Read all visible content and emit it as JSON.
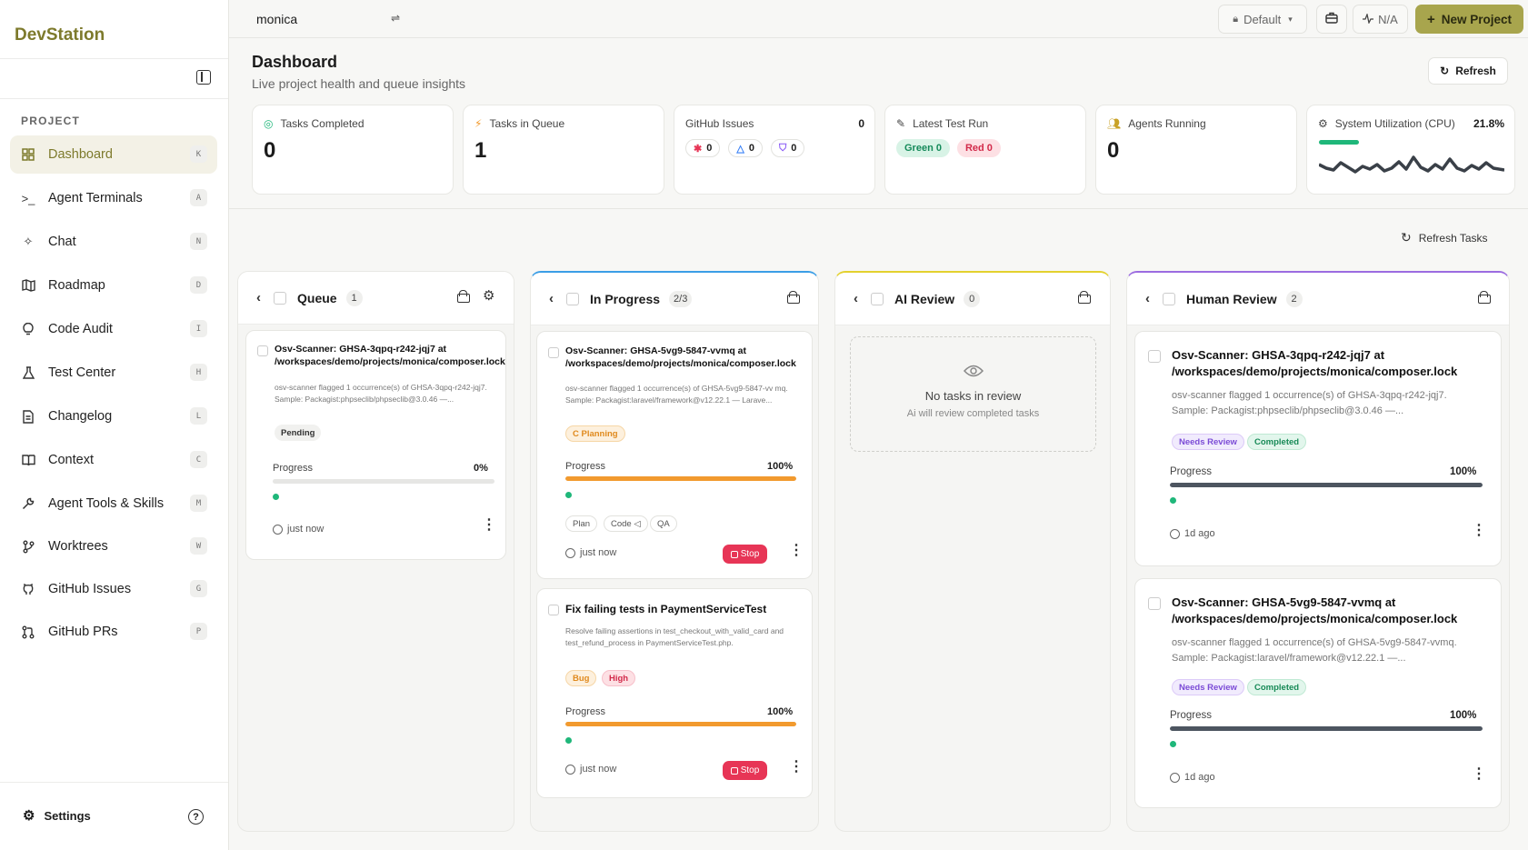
{
  "app": {
    "name": "DevStation",
    "project": "monica"
  },
  "sidebar": {
    "section_label": "PROJECT",
    "items": [
      {
        "label": "Dashboard",
        "shortcut": "K",
        "icon": "grid-icon"
      },
      {
        "label": "Agent Terminals",
        "shortcut": "A",
        "icon": "terminal-icon"
      },
      {
        "label": "Chat",
        "shortcut": "N",
        "icon": "sparkle-icon"
      },
      {
        "label": "Roadmap",
        "shortcut": "D",
        "icon": "map-icon"
      },
      {
        "label": "Code Audit",
        "shortcut": "I",
        "icon": "lightbulb-icon"
      },
      {
        "label": "Test Center",
        "shortcut": "H",
        "icon": "flask-icon"
      },
      {
        "label": "Changelog",
        "shortcut": "L",
        "icon": "document-icon"
      },
      {
        "label": "Context",
        "shortcut": "C",
        "icon": "book-icon"
      },
      {
        "label": "Agent Tools & Skills",
        "shortcut": "M",
        "icon": "wrench-icon"
      },
      {
        "label": "Worktrees",
        "shortcut": "W",
        "icon": "git-branch-icon"
      },
      {
        "label": "GitHub Issues",
        "shortcut": "G",
        "icon": "github-icon"
      },
      {
        "label": "GitHub PRs",
        "shortcut": "P",
        "icon": "git-pull-request-icon"
      }
    ],
    "settings_label": "Settings"
  },
  "topbar": {
    "profile_label": "Default",
    "status_label": "N/A",
    "new_project_label": "New Project"
  },
  "page": {
    "title": "Dashboard",
    "subtitle": "Live project health and queue insights",
    "refresh_label": "Refresh",
    "refresh_tasks_label": "Refresh Tasks"
  },
  "stats": {
    "tasks_completed": {
      "label": "Tasks Completed",
      "value": "0"
    },
    "tasks_in_queue": {
      "label": "Tasks in Queue",
      "value": "1"
    },
    "github_issues": {
      "label": "GitHub Issues",
      "total": "0",
      "bugs": "0",
      "warnings": "0",
      "security": "0"
    },
    "latest_test_run": {
      "label": "Latest Test Run",
      "green": "Green 0",
      "red": "Red 0"
    },
    "agents_running": {
      "label": "Agents Running",
      "value": "0"
    },
    "cpu": {
      "label": "System Utilization (CPU)",
      "value": "21.8%",
      "fraction": 0.218
    }
  },
  "columns": {
    "queue": {
      "title": "Queue",
      "count": "1",
      "cards": [
        {
          "title": "Osv-Scanner: GHSA-3qpq-r242-jqj7 at /workspaces/demo/projects/monica/composer.lock",
          "desc": "osv-scanner flagged 1 occurrence(s) of GHSA-3qpq-r242-jqj7. Sample: Packagist:phpseclib/phpseclib@3.0.46 —...",
          "tag": "Pending",
          "progress_label": "Progress",
          "progress": "0%",
          "progress_fraction": 0,
          "time": "just now"
        }
      ]
    },
    "in_progress": {
      "title": "In Progress",
      "count": "2/3",
      "cards": [
        {
          "title": "Osv-Scanner: GHSA-5vg9-5847-vvmq at /workspaces/demo/projects/monica/composer.lock",
          "desc": "osv-scanner flagged 1 occurrence(s) of GHSA-5vg9-5847-vv mq. Sample: Packagist:laravel/framework@v12.22.1 — Larave...",
          "tag": "C Planning",
          "progress_label": "Progress",
          "progress": "100%",
          "progress_fraction": 1,
          "phases": [
            "Plan",
            "Code ◁",
            "QA"
          ],
          "stop_label": "Stop",
          "time": "just now"
        },
        {
          "title": "Fix failing tests in PaymentServiceTest",
          "desc": "Resolve failing assertions in test_checkout_with_valid_card and test_refund_process in PaymentServiceTest.php.",
          "tags": [
            "Bug",
            "High"
          ],
          "progress_label": "Progress",
          "progress": "100%",
          "progress_fraction": 1,
          "stop_label": "Stop",
          "time": "just now"
        }
      ]
    },
    "ai_review": {
      "title": "AI Review",
      "count": "0",
      "empty_title": "No tasks in review",
      "empty_subtitle": "Ai will review completed tasks"
    },
    "human_review": {
      "title": "Human Review",
      "count": "2",
      "cards": [
        {
          "title": "Osv-Scanner: GHSA-3qpq-r242-jqj7 at /workspaces/demo/projects/monica/composer.lock",
          "desc": "osv-scanner flagged 1 occurrence(s) of GHSA-3qpq-r242-jqj7. Sample: Packagist:phpseclib/phpseclib@3.0.46 —...",
          "tags": [
            "Needs Review",
            "Completed"
          ],
          "progress_label": "Progress",
          "progress": "100%",
          "progress_fraction": 1,
          "time": "1d ago"
        },
        {
          "title": "Osv-Scanner: GHSA-5vg9-5847-vvmq at /workspaces/demo/projects/monica/composer.lock",
          "desc": "osv-scanner flagged 1 occurrence(s) of GHSA-5vg9-5847-vvmq. Sample: Packagist:laravel/framework@v12.22.1 —...",
          "tags": [
            "Needs Review",
            "Completed"
          ],
          "progress_label": "Progress",
          "progress": "100%",
          "progress_fraction": 1,
          "time": "1d ago"
        }
      ]
    }
  },
  "colors": {
    "brand": "#7d7a2c",
    "accent": "#a8a54d",
    "progress_orange": "#f29a2e",
    "progress_slate": "#4d5560",
    "cpu_green": "#1fb77a",
    "stop_red": "#e73556"
  }
}
